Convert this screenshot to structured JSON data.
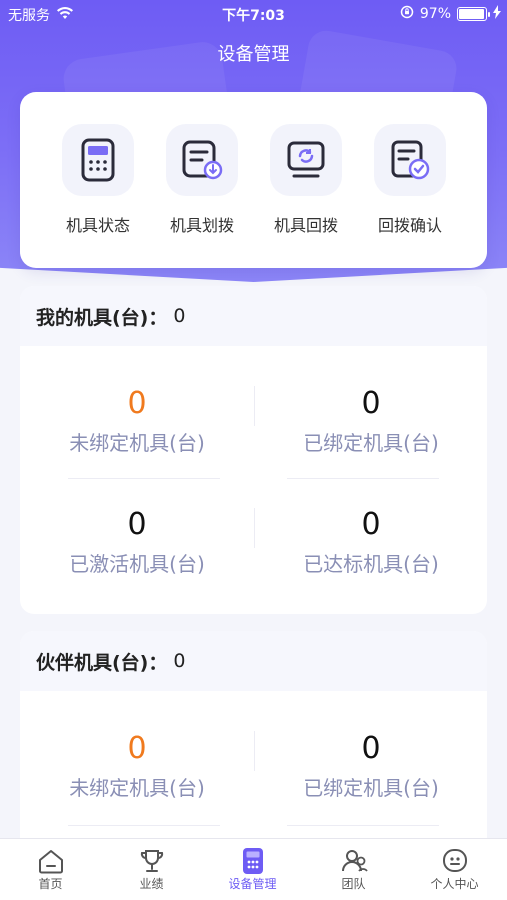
{
  "status_bar": {
    "carrier": "无服务",
    "time": "下午7:03",
    "battery": "97%",
    "battery_level": 0.97
  },
  "header": {
    "title": "设备管理"
  },
  "quick_actions": [
    {
      "label": "机具状态",
      "icon": "calculator-icon"
    },
    {
      "label": "机具划拨",
      "icon": "transfer-out-icon"
    },
    {
      "label": "机具回拨",
      "icon": "return-monitor-icon"
    },
    {
      "label": "回拨确认",
      "icon": "confirm-document-icon"
    }
  ],
  "my_devices": {
    "title": "我的机具(台)：",
    "total": "0",
    "stats": [
      {
        "value": "0",
        "label": "未绑定机具(台)",
        "highlight": true
      },
      {
        "value": "0",
        "label": "已绑定机具(台)",
        "highlight": false
      },
      {
        "value": "0",
        "label": "已激活机具(台)",
        "highlight": false
      },
      {
        "value": "0",
        "label": "已达标机具(台)",
        "highlight": false
      }
    ]
  },
  "partner_devices": {
    "title": "伙伴机具(台)：",
    "total": "0",
    "stats": [
      {
        "value": "0",
        "label": "未绑定机具(台)",
        "highlight": true
      },
      {
        "value": "0",
        "label": "已绑定机具(台)",
        "highlight": false
      }
    ]
  },
  "tabbar": [
    {
      "label": "首页",
      "icon": "home-icon",
      "active": false
    },
    {
      "label": "业绩",
      "icon": "trophy-icon",
      "active": false
    },
    {
      "label": "设备管理",
      "icon": "calculator-icon",
      "active": true
    },
    {
      "label": "团队",
      "icon": "team-icon",
      "active": false
    },
    {
      "label": "个人中心",
      "icon": "profile-icon",
      "active": false
    }
  ],
  "colors": {
    "primary": "#6e5cf4",
    "highlight_number": "#f07a1e",
    "stat_label": "#8a8fb5"
  }
}
